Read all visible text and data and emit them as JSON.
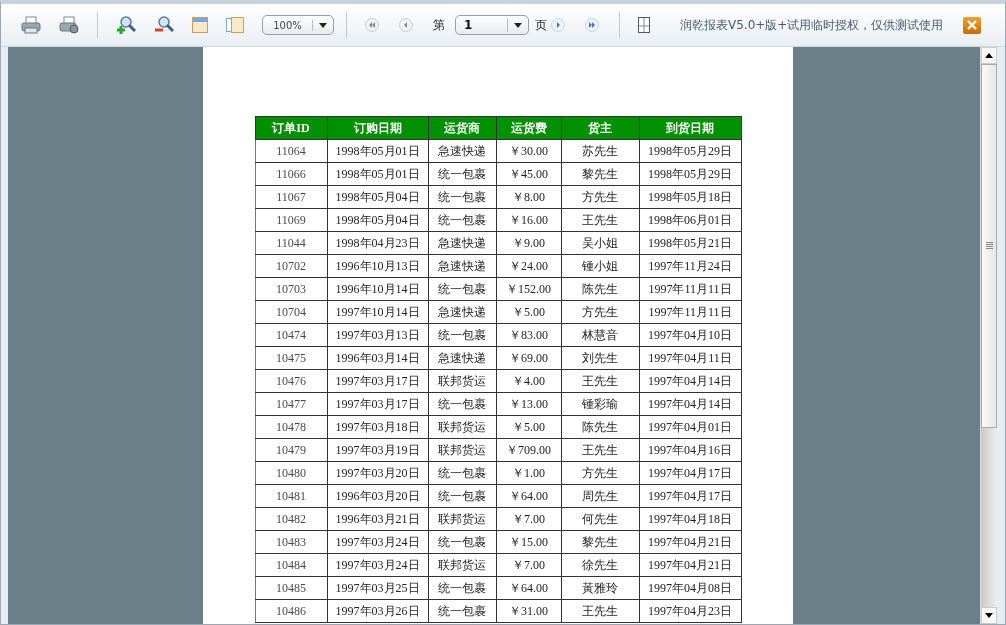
{
  "toolbar": {
    "zoom": "100%",
    "page_prefix": "第",
    "page_value": "1",
    "page_suffix": "页",
    "notice": "润乾报表V5.0+版+试用临时授权，仅供测试使用"
  },
  "table": {
    "columns": [
      "订单ID",
      "订购日期",
      "运货商",
      "运货费",
      "货主",
      "到货日期"
    ],
    "rows": [
      [
        "11064",
        "1998年05月01日",
        "急速快递",
        "￥30.00",
        "苏先生",
        "1998年05月29日"
      ],
      [
        "11066",
        "1998年05月01日",
        "统一包裹",
        "￥45.00",
        "黎先生",
        "1998年05月29日"
      ],
      [
        "11067",
        "1998年05月04日",
        "统一包裹",
        "￥8.00",
        "方先生",
        "1998年05月18日"
      ],
      [
        "11069",
        "1998年05月04日",
        "统一包裹",
        "￥16.00",
        "王先生",
        "1998年06月01日"
      ],
      [
        "11044",
        "1998年04月23日",
        "急速快递",
        "￥9.00",
        "吴小姐",
        "1998年05月21日"
      ],
      [
        "10702",
        "1996年10月13日",
        "急速快递",
        "￥24.00",
        "锺小姐",
        "1997年11月24日"
      ],
      [
        "10703",
        "1996年10月14日",
        "统一包裹",
        "￥152.00",
        "陈先生",
        "1997年11月11日"
      ],
      [
        "10704",
        "1997年10月14日",
        "急速快递",
        "￥5.00",
        "方先生",
        "1997年11月11日"
      ],
      [
        "10474",
        "1997年03月13日",
        "统一包裹",
        "￥83.00",
        "林慧音",
        "1997年04月10日"
      ],
      [
        "10475",
        "1996年03月14日",
        "急速快递",
        "￥69.00",
        "刘先生",
        "1997年04月11日"
      ],
      [
        "10476",
        "1997年03月17日",
        "联邦货运",
        "￥4.00",
        "王先生",
        "1997年04月14日"
      ],
      [
        "10477",
        "1997年03月17日",
        "统一包裹",
        "￥13.00",
        "锺彩瑜",
        "1997年04月14日"
      ],
      [
        "10478",
        "1997年03月18日",
        "联邦货运",
        "￥5.00",
        "陈先生",
        "1997年04月01日"
      ],
      [
        "10479",
        "1997年03月19日",
        "联邦货运",
        "￥709.00",
        "王先生",
        "1997年04月16日"
      ],
      [
        "10480",
        "1997年03月20日",
        "统一包裹",
        "￥1.00",
        "方先生",
        "1997年04月17日"
      ],
      [
        "10481",
        "1996年03月20日",
        "统一包裹",
        "￥64.00",
        "周先生",
        "1997年04月17日"
      ],
      [
        "10482",
        "1996年03月21日",
        "联邦货运",
        "￥7.00",
        "何先生",
        "1997年04月18日"
      ],
      [
        "10483",
        "1997年03月24日",
        "统一包裹",
        "￥15.00",
        "黎先生",
        "1997年04月21日"
      ],
      [
        "10484",
        "1997年03月24日",
        "联邦货运",
        "￥7.00",
        "徐先生",
        "1997年04月21日"
      ],
      [
        "10485",
        "1997年03月25日",
        "统一包裹",
        "￥64.00",
        "黃雅玲",
        "1997年04月08日"
      ],
      [
        "10486",
        "1997年03月26日",
        "统一包裹",
        "￥31.00",
        "王先生",
        "1997年04月23日"
      ]
    ]
  }
}
